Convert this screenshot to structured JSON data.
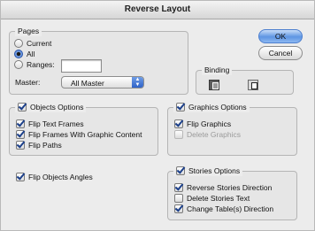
{
  "window": {
    "title": "Reverse Layout"
  },
  "pages": {
    "legend": "Pages",
    "options": [
      "Current",
      "All",
      "Ranges:"
    ],
    "selected": "All",
    "ranges_value": "",
    "master_label": "Master:",
    "master_value": "All Master"
  },
  "buttons": {
    "ok": "OK",
    "cancel": "Cancel"
  },
  "binding": {
    "legend": "Binding",
    "selected": "left"
  },
  "objects": {
    "legend": "Objects Options",
    "items": [
      "Flip Text Frames",
      "Flip Frames With Graphic Content",
      "Flip Paths"
    ]
  },
  "graphics": {
    "legend": "Graphics Options",
    "items": [
      "Flip Graphics",
      "Delete Graphics"
    ]
  },
  "flip_angles": "Flip Objects Angles",
  "stories": {
    "legend": "Stories Options",
    "items": [
      "Reverse Stories Direction",
      "Delete Stories Text",
      "Change Table(s) Direction"
    ]
  },
  "colors": {
    "accent": "#3f74d6",
    "check": "#1b3f8a",
    "disabled_text": "#9a9a9a"
  }
}
